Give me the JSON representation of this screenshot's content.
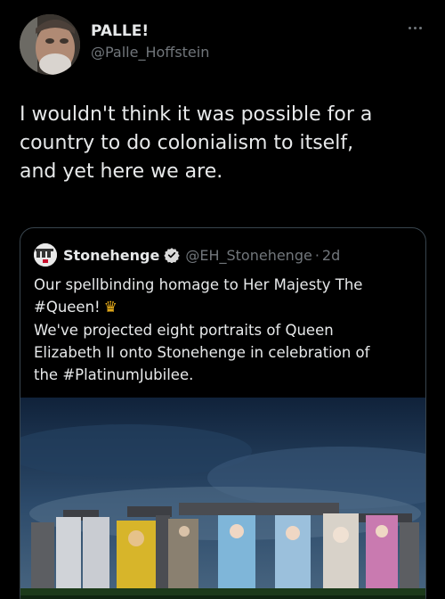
{
  "tweet": {
    "display_name": "PALLE!",
    "handle": "@Palle_Hoffstein",
    "text": "I wouldn't think it was possible for a\ncountry to do colonialism to itself,\nand yet here we are.",
    "more_icon": "more-horizontal-icon"
  },
  "quote": {
    "display_name": "Stonehenge",
    "verified_icon": "verified-badge-icon",
    "handle": "@EH_Stonehenge",
    "separator": "·",
    "time": "2d",
    "lines": [
      "Our spellbinding homage to Her Majesty The",
      "#Queen!",
      "We've projected eight portraits of Queen",
      "Elizabeth II onto Stonehenge in celebration of",
      "the #PlatinumJubilee."
    ],
    "emoji": "♛",
    "emoji_icon": "crown-icon"
  },
  "colors": {
    "background": "#000000",
    "text": "#e7e9ea",
    "secondary": "#71767b",
    "border": "#38444d",
    "verified": "#1d9bf0",
    "crown": "#f2b51c"
  }
}
